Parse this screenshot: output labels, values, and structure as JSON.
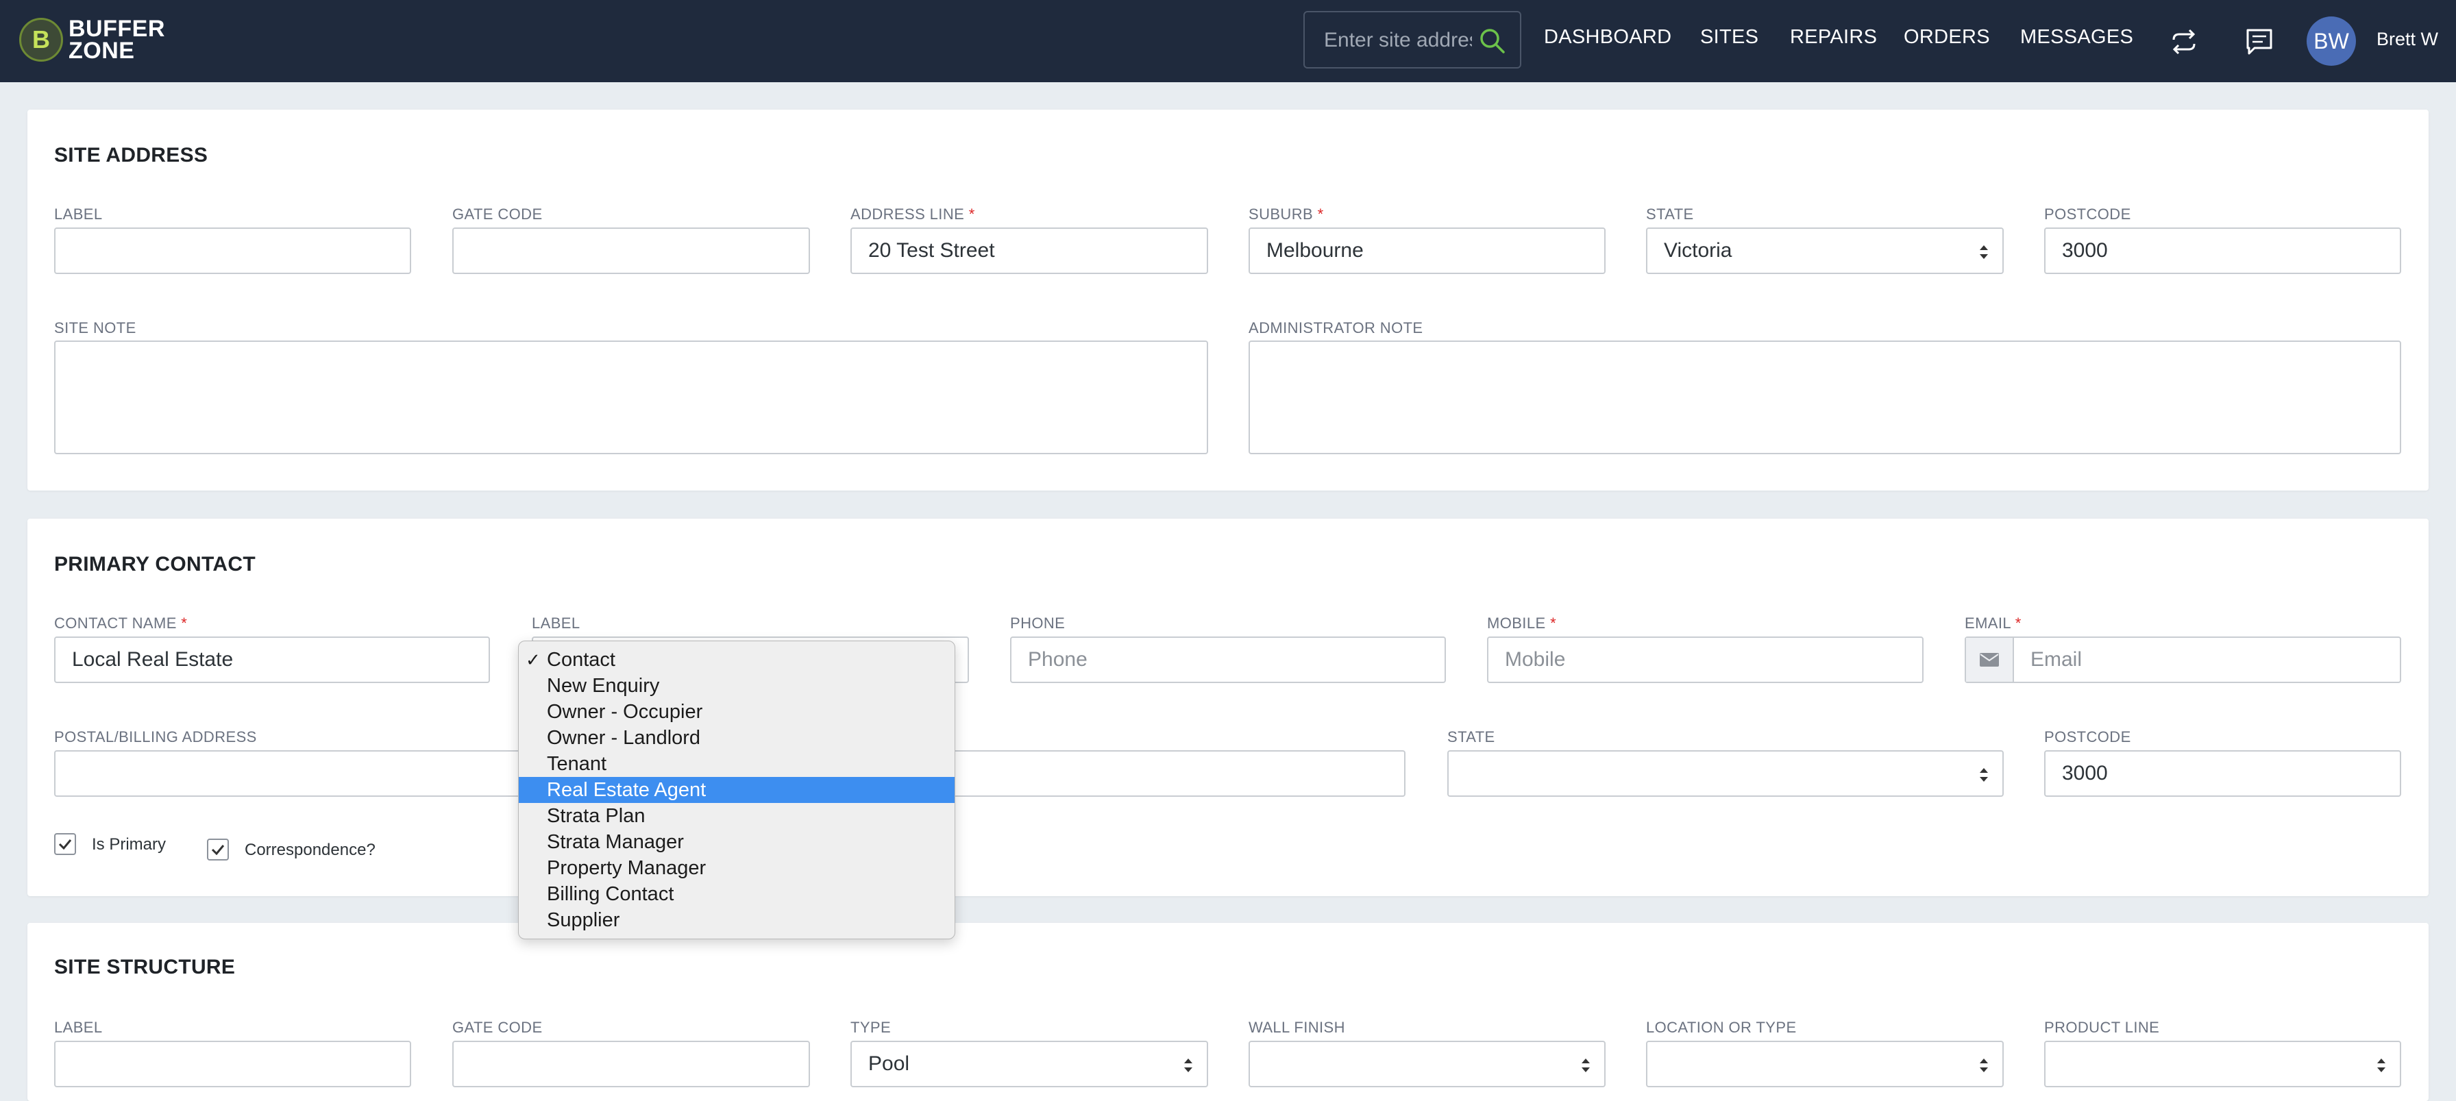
{
  "nav": {
    "brand_line1": "BUFFER",
    "brand_line2": "ZONE",
    "logo_letter": "B",
    "search_placeholder": "Enter site address",
    "links": [
      "DASHBOARD",
      "SITES",
      "REPAIRS",
      "ORDERS",
      "MESSAGES"
    ],
    "avatar_initials": "BW",
    "user_name": "Brett W",
    "icons": [
      "sync-icon",
      "chat-icon"
    ]
  },
  "site_address": {
    "title": "SITE ADDRESS",
    "label": {
      "label": "LABEL",
      "value": ""
    },
    "gate_code": {
      "label": "GATE CODE",
      "value": ""
    },
    "address_line": {
      "label": "ADDRESS LINE",
      "value": "20 Test Street"
    },
    "suburb": {
      "label": "SUBURB",
      "value": "Melbourne"
    },
    "state": {
      "label": "STATE",
      "value": "Victoria"
    },
    "postcode": {
      "label": "POSTCODE",
      "value": "3000"
    },
    "site_note": {
      "label": "SITE NOTE"
    },
    "admin_note": {
      "label": "ADMINISTRATOR NOTE"
    }
  },
  "primary_contact": {
    "title": "PRIMARY CONTACT",
    "contact_name": {
      "label": "CONTACT NAME",
      "value": "Local Real Estate"
    },
    "contact_label": {
      "label": "LABEL"
    },
    "phone": {
      "label": "PHONE",
      "placeholder": "Phone"
    },
    "mobile": {
      "label": "MOBILE",
      "placeholder": "Mobile"
    },
    "email": {
      "label": "EMAIL",
      "placeholder": "Email"
    },
    "postal": {
      "label": "POSTAL/BILLING ADDRESS",
      "value": ""
    },
    "state": {
      "label": "STATE",
      "value": ""
    },
    "postcode": {
      "label": "POSTCODE",
      "value": "3000"
    },
    "is_primary": "Is Primary",
    "correspondence": "Correspondence?",
    "required_mark": "*"
  },
  "dropdown": {
    "checked_mark": "✓",
    "options": [
      "Contact",
      "New Enquiry",
      "Owner - Occupier",
      "Owner - Landlord",
      "Tenant",
      "Real Estate Agent",
      "Strata Plan",
      "Strata Manager",
      "Property Manager",
      "Billing Contact",
      "Supplier"
    ],
    "checked_index": 0,
    "highlighted_index": 5
  },
  "site_structure": {
    "title": "SITE STRUCTURE",
    "label": "LABEL",
    "gate_code": "GATE CODE",
    "type": {
      "label": "TYPE",
      "value": "Pool"
    },
    "wall_finish": "WALL FINISH",
    "location_or_type": "LOCATION OR TYPE",
    "product_line": "PRODUCT LINE"
  },
  "colors": {
    "navbar": "#1f2a3d",
    "accent_green": "#6cc24a",
    "avatar": "#4a6cb5",
    "highlight": "#3d8ef0",
    "required": "#dc2626"
  }
}
